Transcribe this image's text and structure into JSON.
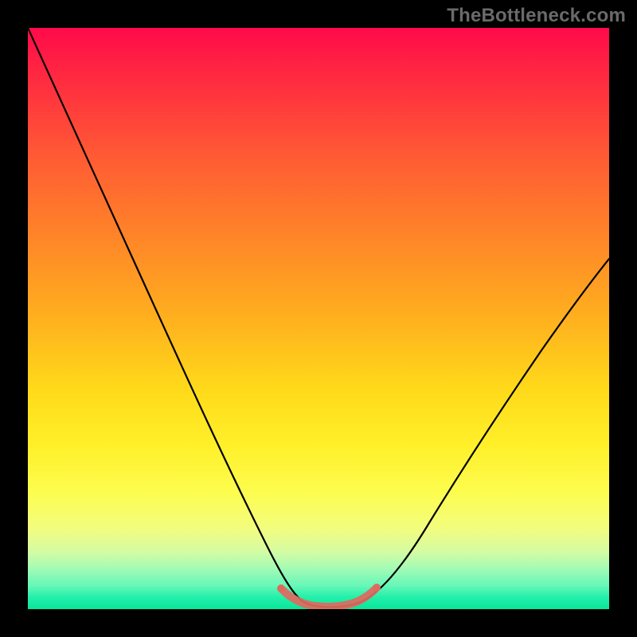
{
  "watermark": "TheBottleneck.com",
  "colors": {
    "background": "#000000",
    "curve": "#000000",
    "highlight": "#e0695e",
    "gradient_top": "#ff0a4a",
    "gradient_bottom": "#08e79a"
  },
  "chart_data": {
    "type": "line",
    "title": "",
    "xlabel": "",
    "ylabel": "",
    "xlim": [
      0,
      100
    ],
    "ylim": [
      0,
      100
    ],
    "x": [
      0,
      5,
      10,
      15,
      20,
      25,
      30,
      35,
      40,
      45,
      48,
      50,
      52,
      54,
      56,
      58,
      60,
      63,
      67,
      72,
      78,
      85,
      92,
      100
    ],
    "values": [
      100,
      89,
      78,
      68,
      58,
      48,
      38,
      28,
      19,
      10,
      5,
      2,
      1,
      1,
      1,
      2,
      4,
      8,
      14,
      22,
      31,
      41,
      50,
      58
    ],
    "highlight_range_x": [
      45,
      60
    ],
    "annotations": []
  }
}
